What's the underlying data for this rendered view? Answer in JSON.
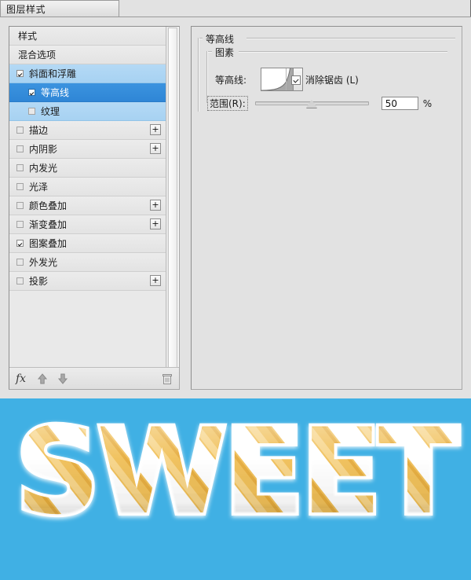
{
  "app": {
    "title": "图层样式",
    "background_color": "#40b0e4",
    "dialog_bg": "#e2e2e2",
    "accent_selected": "#2f86d6",
    "accent_soft": "#a7d2f2"
  },
  "style_list": {
    "scrollbar": "vertical-scrollbar",
    "items": [
      {
        "label": "样式",
        "checkbox": "none",
        "indent": false,
        "highlight": "none",
        "plus": false
      },
      {
        "label": "混合选项",
        "checkbox": "none",
        "indent": false,
        "highlight": "none",
        "plus": false
      },
      {
        "label": "斜面和浮雕",
        "checkbox": "checked",
        "indent": false,
        "highlight": "soft",
        "plus": false
      },
      {
        "label": "等高线",
        "checkbox": "checked",
        "indent": true,
        "highlight": "strong",
        "plus": false
      },
      {
        "label": "纹理",
        "checkbox": "unchecked",
        "indent": true,
        "highlight": "soft",
        "plus": false
      },
      {
        "label": "描边",
        "checkbox": "unchecked",
        "indent": false,
        "highlight": "none",
        "plus": true
      },
      {
        "label": "内阴影",
        "checkbox": "unchecked",
        "indent": false,
        "highlight": "none",
        "plus": true
      },
      {
        "label": "内发光",
        "checkbox": "unchecked",
        "indent": false,
        "highlight": "none",
        "plus": false
      },
      {
        "label": "光泽",
        "checkbox": "unchecked",
        "indent": false,
        "highlight": "none",
        "plus": false
      },
      {
        "label": "颜色叠加",
        "checkbox": "unchecked",
        "indent": false,
        "highlight": "none",
        "plus": true
      },
      {
        "label": "渐变叠加",
        "checkbox": "unchecked",
        "indent": false,
        "highlight": "none",
        "plus": true
      },
      {
        "label": "图案叠加",
        "checkbox": "checked",
        "indent": false,
        "highlight": "none",
        "plus": false
      },
      {
        "label": "外发光",
        "checkbox": "unchecked",
        "indent": false,
        "highlight": "none",
        "plus": false
      },
      {
        "label": "投影",
        "checkbox": "unchecked",
        "indent": false,
        "highlight": "none",
        "plus": true
      }
    ],
    "footer": {
      "fx_label": "fx",
      "move_up_icon": "arrow-up-icon",
      "move_down_icon": "arrow-down-icon",
      "delete_icon": "trash-icon"
    },
    "plus_label": "+"
  },
  "settings_panel": {
    "group_title": "等高线",
    "subgroup_title": "图素",
    "contour": {
      "label": "等高线:",
      "preview_icon": "contour-curve-preview",
      "dropdown_icon": "chevron-down-icon"
    },
    "antialias": {
      "label": "消除锯齿 (L)",
      "checked": true
    },
    "range": {
      "label": "范围(R):",
      "value": "50",
      "unit": "%",
      "slider_percent": 50
    }
  },
  "artwork": {
    "text": "SWEET",
    "style": "candy-cane striped lettering",
    "sky_color": "#40b0e4",
    "stripe_white": "#ffffff",
    "stripe_gold": "#f2c35b"
  }
}
